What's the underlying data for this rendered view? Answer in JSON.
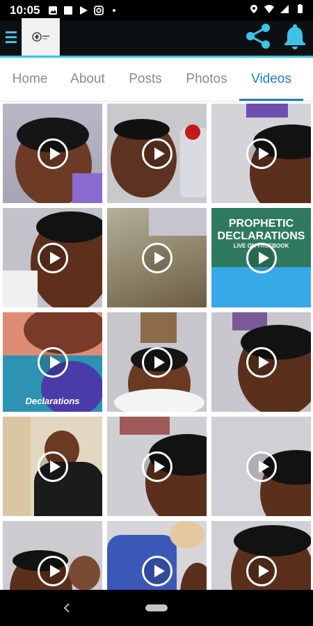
{
  "status_bar": {
    "time": "10:05",
    "left_icons": [
      "image-icon",
      "square-icon",
      "play-store-icon",
      "instagram-icon",
      "dot-icon"
    ],
    "right_icons": [
      "location-icon",
      "wifi-icon",
      "signal-icon",
      "battery-icon"
    ]
  },
  "app_bar": {
    "menu_icon": "hamburger-icon",
    "logo_icon": "church-logo-icon",
    "share_icon": "share-icon",
    "notification_icon": "bell-icon",
    "accent_color": "#3fc2e6"
  },
  "tabs": [
    {
      "label": "Home",
      "active": false
    },
    {
      "label": "About",
      "active": false
    },
    {
      "label": "Posts",
      "active": false
    },
    {
      "label": "Photos",
      "active": false
    },
    {
      "label": "Videos",
      "active": true
    }
  ],
  "active_tab_color": "#1f7ec2",
  "videos": [
    {
      "title": ""
    },
    {
      "title": ""
    },
    {
      "title": ""
    },
    {
      "title": ""
    },
    {
      "title": ""
    },
    {
      "title": "PROPHETIC DECLARATIONS",
      "subtitle": "LIVE ON FACEBOOK"
    },
    {
      "title": "Declarations"
    },
    {
      "title": ""
    },
    {
      "title": ""
    },
    {
      "title": ""
    },
    {
      "title": ""
    },
    {
      "title": ""
    },
    {
      "title": ""
    },
    {
      "title": ""
    },
    {
      "title": ""
    }
  ],
  "nav_bar": {
    "back_icon": "back-chevron-icon",
    "home_icon": "home-pill-icon"
  }
}
